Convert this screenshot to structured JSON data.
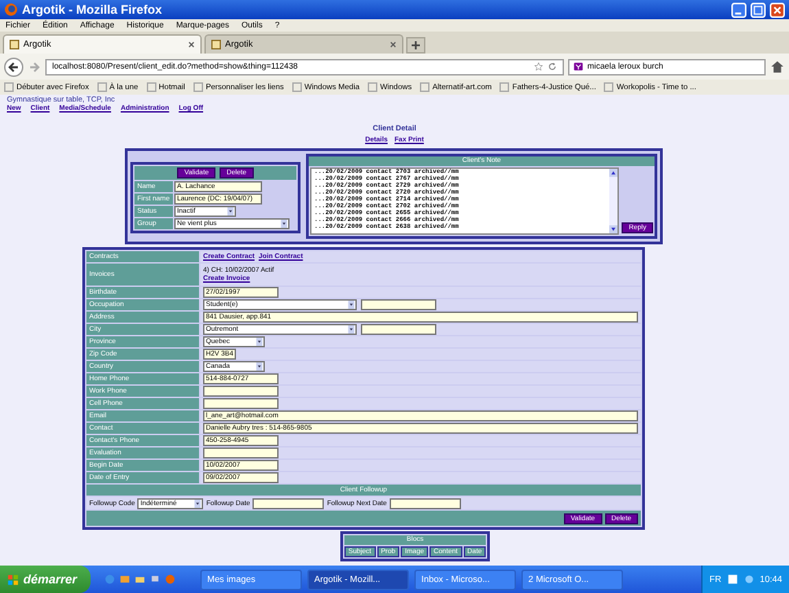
{
  "window": {
    "title": "Argotik - Mozilla Firefox"
  },
  "menu": [
    "Fichier",
    "Édition",
    "Affichage",
    "Historique",
    "Marque-pages",
    "Outils",
    "?"
  ],
  "tabs": [
    {
      "label": "Argotik",
      "selected": true
    },
    {
      "label": "Argotik",
      "selected": false
    }
  ],
  "address_bar": {
    "url": "localhost:8080/Present/client_edit.do?method=show&thing=112438"
  },
  "search": {
    "value": "micaela leroux burch"
  },
  "bookmarks": [
    "Débuter avec Firefox",
    "À la une",
    "Hotmail",
    "Personnaliser les liens",
    "Windows Media",
    "Windows",
    "Alternatif-art.com",
    "Fathers-4-Justice Qué...",
    "Workopolis - Time to ..."
  ],
  "page": {
    "org": "Gymnastique sur table, TCP, Inc",
    "nav_links": [
      "New",
      "Client",
      "Media/Schedule",
      "Administration",
      "Log Off"
    ],
    "heading": "Client Detail",
    "sub_links": [
      "Details",
      "Fax Print"
    ],
    "identity": {
      "buttons": [
        "Validate",
        "Delete"
      ],
      "fields": [
        {
          "label": "Name",
          "kind": "text",
          "value": "A. Lachance"
        },
        {
          "label": "First name",
          "kind": "text",
          "value": "Laurence (DC: 19/04/07)"
        },
        {
          "label": "Status",
          "kind": "select",
          "value": "Inactif"
        },
        {
          "label": "Group",
          "kind": "select",
          "value": "Ne vient plus"
        }
      ]
    },
    "notes": {
      "title": "Client's Note",
      "lines": [
        "...20/02/2009 contact 2703 archived//mm",
        "...20/02/2009 contact 2767 archived//mm",
        "...20/02/2009 contact 2729 archived//mm",
        "...20/02/2009 contact 2720 archived//mm",
        "...20/02/2009 contact 2714 archived//mm",
        "...20/02/2009 contact 2702 archived//mm",
        "...20/02/2009 contact 2655 archived//mm",
        "...20/02/2009 contact 2666 archived//mm",
        "...20/02/2009 contact 2638 archived//mm"
      ],
      "button": "Reply"
    },
    "details": [
      {
        "label": "Contracts",
        "kind": "links",
        "links": [
          "Create Contract",
          "Join Contract"
        ]
      },
      {
        "label": "Invoices",
        "kind": "invoice",
        "text": "4) CH: 10/02/2007 Actif",
        "link": "Create Invoice"
      },
      {
        "label": "Birthdate",
        "kind": "short",
        "value": "27/02/1997"
      },
      {
        "label": "Occupation",
        "kind": "select-extra",
        "value": "Student(e)"
      },
      {
        "label": "Address",
        "kind": "long",
        "value": "841 Dausier, app.841"
      },
      {
        "label": "City",
        "kind": "select-extra",
        "value": "Outremont"
      },
      {
        "label": "Province",
        "kind": "select",
        "value": "Quebec"
      },
      {
        "label": "Zip Code",
        "kind": "tiny",
        "value": "H2V 3B4"
      },
      {
        "label": "Country",
        "kind": "select",
        "value": "Canada"
      },
      {
        "label": "Home Phone",
        "kind": "short",
        "value": "514-884-0727"
      },
      {
        "label": "Work Phone",
        "kind": "short"
      },
      {
        "label": "Cell Phone",
        "kind": "short"
      },
      {
        "label": "Email",
        "kind": "long",
        "value": "l_ane_art@hotmail.com"
      },
      {
        "label": "Contact",
        "kind": "long",
        "value": "Danielle Aubry  tres : 514-865-9805"
      },
      {
        "label": "Contact's Phone",
        "kind": "short",
        "value": "450-258-4945"
      },
      {
        "label": "Evaluation",
        "kind": "short"
      },
      {
        "label": "Begin Date",
        "kind": "short",
        "value": "10/02/2007"
      },
      {
        "label": "Date of Entry",
        "kind": "short",
        "value": "09/02/2007"
      }
    ],
    "followup": {
      "title": "Client Followup",
      "code_label": "Followup Code",
      "code_value": "Indéterminé",
      "date_label": "Followup Date",
      "next_label": "Followup Next Date",
      "buttons": [
        "Validate",
        "Delete"
      ]
    },
    "blocs": {
      "title": "Blocs",
      "buttons": [
        "Subject",
        "Prob",
        "Image",
        "Content",
        "Date"
      ]
    }
  },
  "taskbar": {
    "start": "démarrer",
    "tasks": [
      {
        "label": "Mes images",
        "selected": false
      },
      {
        "label": "Argotik - Mozill...",
        "selected": true
      },
      {
        "label": "Inbox - Microso...",
        "selected": false
      },
      {
        "label": "2 Microsoft O...",
        "selected": false
      }
    ],
    "lang": "FR",
    "clock": "10:44"
  }
}
